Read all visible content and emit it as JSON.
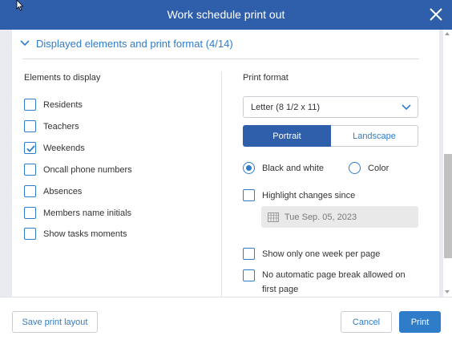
{
  "window": {
    "title": "Work schedule print out"
  },
  "section": {
    "toggle_label": "Displayed elements and print format (4/14)"
  },
  "elements": {
    "title": "Elements to display",
    "items": [
      {
        "label": "Residents",
        "checked": false
      },
      {
        "label": "Teachers",
        "checked": false
      },
      {
        "label": "Weekends",
        "checked": true
      },
      {
        "label": "Oncall phone numbers",
        "checked": false
      },
      {
        "label": "Absences",
        "checked": false
      },
      {
        "label": "Members name initials",
        "checked": false
      },
      {
        "label": "Show tasks moments",
        "checked": false
      }
    ]
  },
  "print_format": {
    "title": "Print format",
    "paper_size": "Letter (8 1/2 x 11)",
    "orientation": {
      "portrait": "Portrait",
      "landscape": "Landscape",
      "selected": "Portrait"
    },
    "color_mode": {
      "bw": "Black and white",
      "color": "Color",
      "selected": "bw"
    },
    "highlight_label": "Highlight changes since",
    "highlight_checked": false,
    "highlight_date": "Tue Sep. 05, 2023",
    "one_week_label": "Show only one week per page",
    "one_week_checked": false,
    "no_break_label": "No automatic page break allowed on first page",
    "no_break_checked": false
  },
  "footer": {
    "save_layout": "Save print layout",
    "cancel": "Cancel",
    "print": "Print"
  },
  "colors": {
    "header": "#2f5fab",
    "accent": "#2f7cc9",
    "background": "#e9ebf0"
  }
}
